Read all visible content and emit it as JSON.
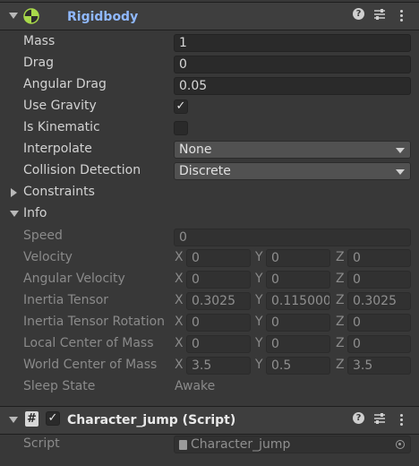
{
  "rigidbody": {
    "title": "Rigidbody",
    "fields": {
      "mass": {
        "label": "Mass",
        "value": "1"
      },
      "drag": {
        "label": "Drag",
        "value": "0"
      },
      "angular_drag": {
        "label": "Angular Drag",
        "value": "0.05"
      },
      "use_gravity": {
        "label": "Use Gravity",
        "checked": true,
        "mark": "✓"
      },
      "is_kinematic": {
        "label": "Is Kinematic",
        "checked": false
      },
      "interpolate": {
        "label": "Interpolate",
        "value": "None"
      },
      "collision_detection": {
        "label": "Collision Detection",
        "value": "Discrete"
      }
    },
    "constraints_label": "Constraints",
    "info": {
      "label": "Info",
      "speed": {
        "label": "Speed",
        "value": "0"
      },
      "velocity": {
        "label": "Velocity",
        "x": "0",
        "y": "0",
        "z": "0"
      },
      "angular_velocity": {
        "label": "Angular Velocity",
        "x": "0",
        "y": "0",
        "z": "0"
      },
      "inertia_tensor": {
        "label": "Inertia Tensor",
        "x": "0.3025",
        "y": "0.115000",
        "z": "0.3025"
      },
      "inertia_tensor_rotation": {
        "label": "Inertia Tensor Rotation",
        "x": "0",
        "y": "0",
        "z": "0"
      },
      "local_center_of_mass": {
        "label": "Local Center of Mass",
        "x": "0",
        "y": "0",
        "z": "0"
      },
      "world_center_of_mass": {
        "label": "World Center of Mass",
        "x": "3.5",
        "y": "0.5",
        "z": "3.5"
      },
      "sleep_state": {
        "label": "Sleep State",
        "value": "Awake"
      }
    },
    "axis_labels": {
      "x": "X",
      "y": "Y",
      "z": "Z"
    }
  },
  "script_component": {
    "title": "Character_jump (Script)",
    "enabled_mark": "✓",
    "hash_glyph": "#",
    "script_label": "Script",
    "script_value": "Character_jump"
  },
  "header_icons": {
    "help": "?",
    "kebab": "⋮"
  },
  "colors": {
    "background": "#383838",
    "title_blue": "#8fb8ff",
    "field_bg": "#2a2a2a"
  }
}
